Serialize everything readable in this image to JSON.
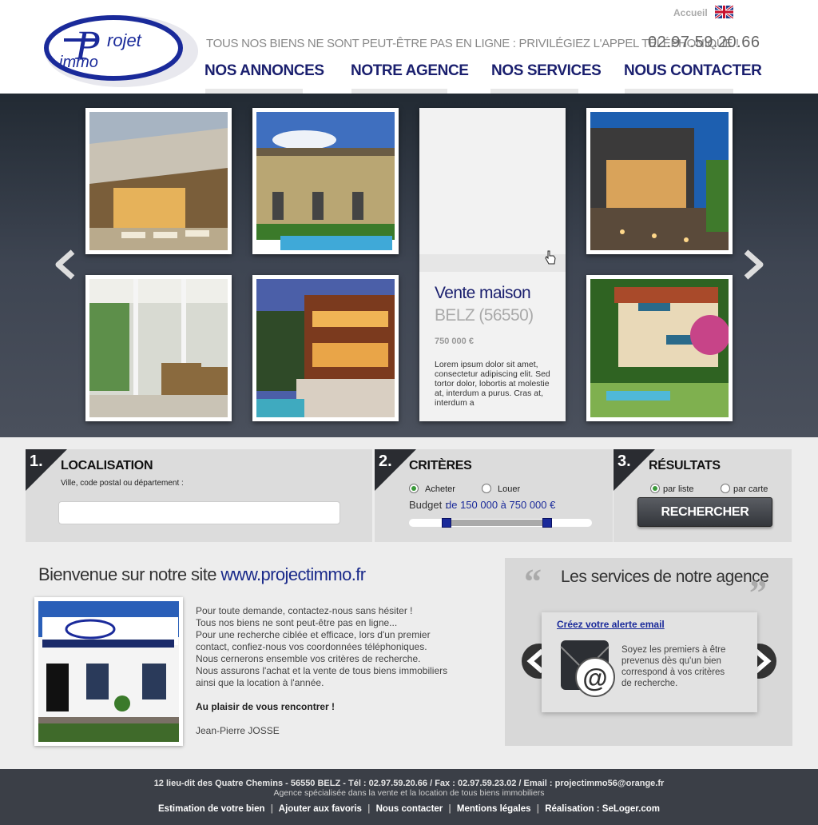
{
  "header": {
    "accueil": "Accueil",
    "tagline": "TOUS NOS BIENS NE SONT PEUT-ÊTRE PAS EN LIGNE : PRIVILÉGIEZ L'APPEL TÉLÉPHONIQUE !",
    "phone": "02.97.59.20.66",
    "logo_text": "iProjet Immo",
    "nav": [
      "NOS ANNONCES",
      "NOTRE AGENCE",
      "NOS SERVICES",
      "NOUS CONTACTER"
    ]
  },
  "featured": {
    "title": "Vente maison",
    "location": "BELZ (56550)",
    "price": "750 000 €",
    "description": "Lorem ipsum dolor sit amet, consectetur adipiscing elit. Sed tortor dolor, lobortis at molestie at, interdum a purus. Cras at, interdum a"
  },
  "search": {
    "step1": {
      "num": "1.",
      "title": "LOCALISATION",
      "hint": "Ville, code postal ou département :",
      "value": ""
    },
    "step2": {
      "num": "2.",
      "title": "CRITÈRES",
      "opt_buy": "Acheter",
      "opt_rent": "Louer",
      "budget_label": "Budget :",
      "budget_value": "de 150 000 à 750 000 €"
    },
    "step3": {
      "num": "3.",
      "title": "RÉSULTATS",
      "opt_list": "par liste",
      "opt_map": "par carte",
      "button": "RECHERCHER"
    }
  },
  "welcome": {
    "title_prefix": "Bienvenue sur notre site",
    "site": "www.projectimmo.fr",
    "lines": [
      "Pour toute demande, contactez-nous sans hésiter !",
      "Tous nos biens ne sont peut-être pas en ligne...",
      "Pour une recherche ciblée et efficace, lors d'un premier",
      "contact, confiez-nous vos coordonnées téléphoniques.",
      "Nous cernerons ensemble vos critères de recherche.",
      "Nous assurons l'achat et la vente de tous biens immobiliers",
      "ainsi que la location à l'année."
    ],
    "closing": "Au plaisir de vous rencontrer !",
    "signature": "Jean-Pierre JOSSE"
  },
  "services": {
    "title": "Les services de notre agence",
    "card_link": "Créez votre alerte email",
    "card_text": "Soyez les premiers à être prevenus dès qu'un bien correspond à vos critères de recherche."
  },
  "footer": {
    "address": "12 lieu-dit des Quatre Chemins - 56550 BELZ - Tél : 02.97.59.20.66 / Fax : 02.97.59.23.02 / Email : projectimmo56@orange.fr",
    "tagline": "Agence spécialisée dans la vente et la location de tous biens immobiliers",
    "links": [
      "Estimation de votre bien",
      "Ajouter aux favoris",
      "Nous contacter",
      "Mentions légales",
      "Réalisation : SeLoger.com"
    ]
  },
  "colors": {
    "nav": "#1a1f6e",
    "brand_blue": "#1a2a8a",
    "dark": "#3b3f47"
  }
}
